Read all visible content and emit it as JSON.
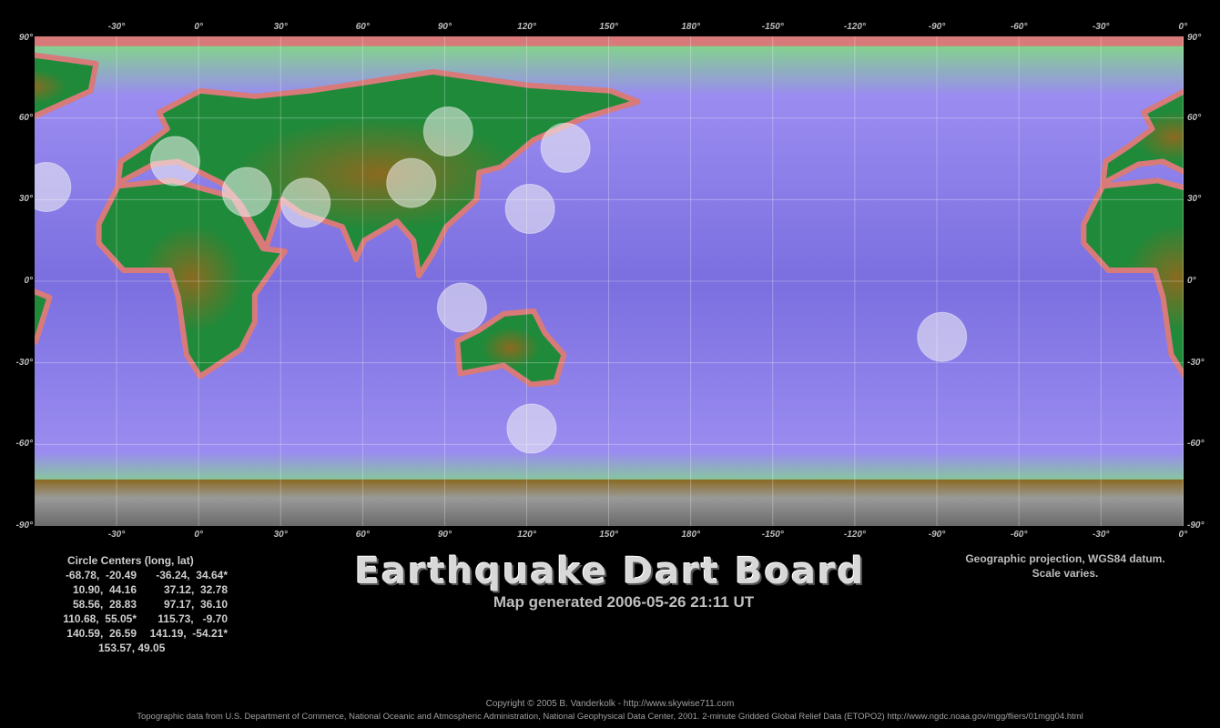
{
  "axis": {
    "lon_labels": [
      "-30°",
      "0°",
      "30°",
      "60°",
      "90°",
      "120°",
      "150°",
      "180°",
      "-150°",
      "-120°",
      "-90°",
      "-60°",
      "-30°",
      "0°",
      "30°"
    ],
    "lat_labels": [
      "90°",
      "60°",
      "30°",
      "0°",
      "-30°",
      "-60°",
      "-90°"
    ]
  },
  "map": {
    "colors": {
      "ocean_deep": "#7b6fe0",
      "ocean_mid": "#9a8cf0",
      "shelf": "#7fe07a",
      "coast": "#d87a7a",
      "lowland": "#1f8a3a",
      "highland": "#8a6a20",
      "ice": "#9a9a9a"
    },
    "circles": [
      {
        "lon": -68.78,
        "lat": -20.49,
        "color": "#f4f4f4"
      },
      {
        "lon": -36.24,
        "lat": 34.64,
        "color": "#f4f4f4"
      },
      {
        "lon": 10.9,
        "lat": 44.16,
        "color": "#f4f4f4"
      },
      {
        "lon": 37.12,
        "lat": 32.78,
        "color": "#f4f4f4"
      },
      {
        "lon": 58.56,
        "lat": 28.83,
        "color": "#f4f4f4"
      },
      {
        "lon": 97.17,
        "lat": 36.1,
        "color": "#f4f4f4"
      },
      {
        "lon": 110.68,
        "lat": 55.05,
        "color": "#f4f4f4"
      },
      {
        "lon": 115.73,
        "lat": -9.7,
        "color": "#f4f4f4"
      },
      {
        "lon": 140.59,
        "lat": 26.59,
        "color": "#f4f4f4"
      },
      {
        "lon": 141.19,
        "lat": -54.21,
        "color": "#f4f4f4"
      },
      {
        "lon": 153.57,
        "lat": 49.05,
        "color": "#f4f4f4"
      }
    ]
  },
  "title": "Earthquake Dart Board",
  "subtitle": "Map generated 2006-05-26 21:11 UT",
  "projection_line1": "Geographic projection, WGS84 datum.",
  "projection_line2": "Scale varies.",
  "centers": {
    "header": "Circle Centers (long, lat)",
    "rows": [
      [
        "-68.78,  -20.49",
        "-36.24,  34.64*"
      ],
      [
        "10.90,  44.16",
        "37.12,  32.78"
      ],
      [
        "58.56,  28.83",
        "97.17,  36.10"
      ],
      [
        "110.68,  55.05*",
        "115.73,   -9.70"
      ],
      [
        "140.59,  26.59",
        "141.19,  -54.21*"
      ]
    ],
    "last": "153.57,  49.05"
  },
  "copyright": "Copyright © 2005 B. Vanderkolk - http://www.skywise711.com",
  "credits": "Topographic data from U.S. Department of Commerce, National Oceanic and Atmospheric Administration, National Geophysical Data Center, 2001. 2-minute Gridded Global Relief Data (ETOPO2) http://www.ngdc.noaa.gov/mgg/fliers/01mgg04.html"
}
